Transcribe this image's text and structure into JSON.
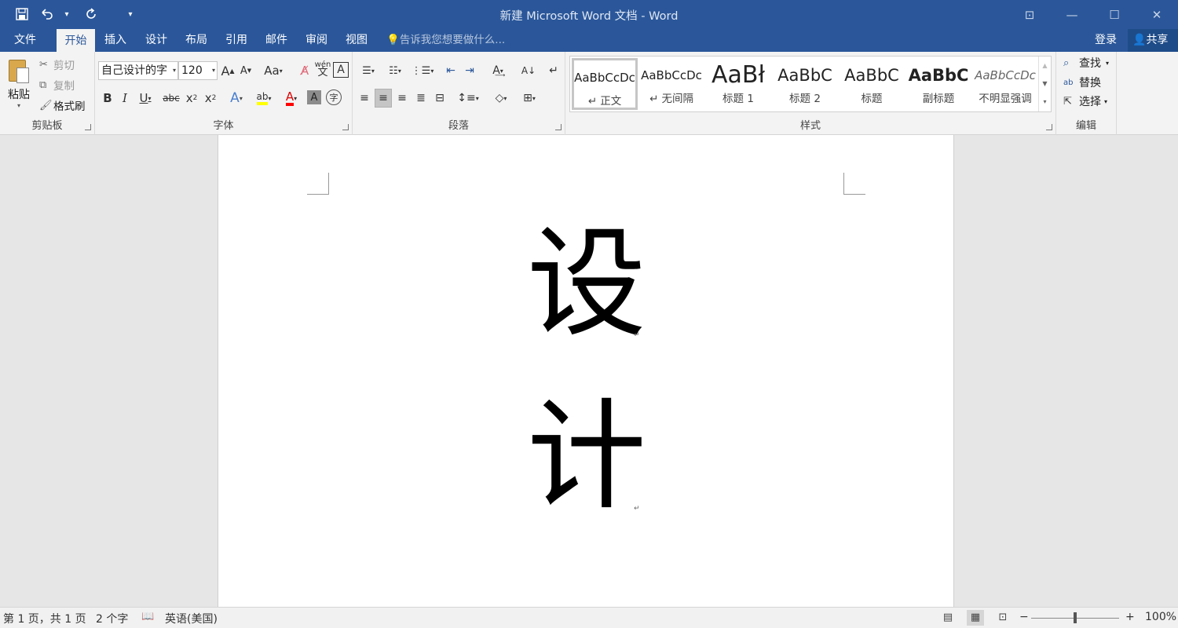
{
  "titlebar": {
    "title": "新建 Microsoft Word 文档 - Word",
    "save_icon": "save-icon",
    "undo_icon": "undo-icon",
    "redo_icon": "redo-icon"
  },
  "tabs": {
    "file": "文件",
    "home": "开始",
    "insert": "插入",
    "design": "设计",
    "layout": "布局",
    "references": "引用",
    "mailings": "邮件",
    "review": "审阅",
    "view": "视图",
    "tellme": "告诉我您想要做什么...",
    "login": "登录",
    "share": "共享"
  },
  "clipboard": {
    "paste": "粘贴",
    "cut": "剪切",
    "copy": "复制",
    "format_painter": "格式刷",
    "group_label": "剪贴板"
  },
  "font": {
    "font_name": "自己设计的字",
    "font_size": "120",
    "group_label": "字体",
    "change_case": "Aa",
    "phonetic_top": "wén",
    "phonetic_bottom": "文"
  },
  "paragraph": {
    "group_label": "段落"
  },
  "styles": {
    "group_label": "样式",
    "items": [
      {
        "preview": "AaBbCcDc",
        "name": "↵ 正文"
      },
      {
        "preview": "AaBbCcDc",
        "name": "↵ 无间隔"
      },
      {
        "preview": "AaBł",
        "name": "标题 1"
      },
      {
        "preview": "AaBbC",
        "name": "标题 2"
      },
      {
        "preview": "AaBbC",
        "name": "标题"
      },
      {
        "preview": "AaBbC",
        "name": "副标题"
      },
      {
        "preview": "AaBbCcDc",
        "name": "不明显强调"
      }
    ]
  },
  "editing": {
    "find": "查找",
    "replace": "替换",
    "select": "选择",
    "group_label": "编辑"
  },
  "document": {
    "line1": "设",
    "line2": "计",
    "paragraph_mark": "↵"
  },
  "status": {
    "page": "第 1 页，共 1 页",
    "words": "2 个字",
    "language": "英语(美国)",
    "zoom": "100%",
    "zoom_fraction": 0.5
  },
  "colors": {
    "accent": "#2b579a",
    "highlight": "#ffff00",
    "font_color": "#ff0000"
  }
}
